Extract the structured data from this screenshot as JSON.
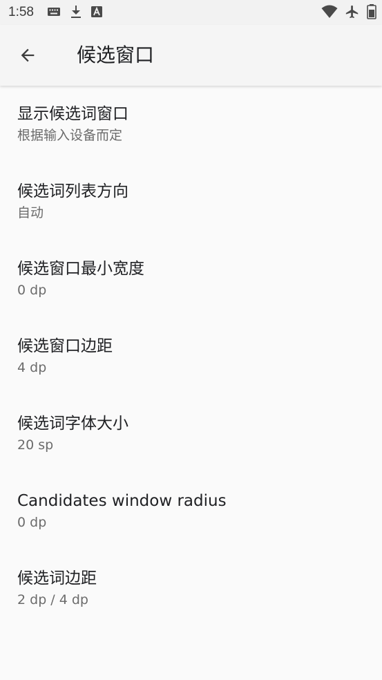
{
  "status_bar": {
    "time": "1:58",
    "left_icons": [
      "keyboard-icon",
      "download-icon",
      "font-icon"
    ],
    "right_icons": [
      "wifi-icon",
      "airplane-icon",
      "battery-icon"
    ]
  },
  "app_bar": {
    "title": "候选窗口",
    "back_icon": "arrow-back-icon"
  },
  "preferences": [
    {
      "title": "显示候选词窗口",
      "summary": "根据输入设备而定"
    },
    {
      "title": "候选词列表方向",
      "summary": "自动"
    },
    {
      "title": "候选窗口最小宽度",
      "summary": "0 dp"
    },
    {
      "title": "候选窗口边距",
      "summary": "4 dp"
    },
    {
      "title": "候选词字体大小",
      "summary": "20 sp"
    },
    {
      "title": "Candidates window radius",
      "summary": "0 dp"
    },
    {
      "title": "候选词边距",
      "summary": "2 dp / 4 dp"
    }
  ],
  "colors": {
    "background": "#fafafa",
    "title_text": "#202124",
    "summary_text": "#6b6b6b"
  }
}
